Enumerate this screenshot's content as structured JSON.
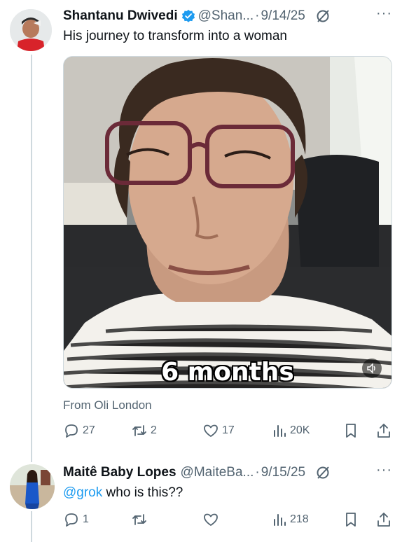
{
  "colors": {
    "link": "#1d9bf0",
    "muted": "#536471",
    "text": "#0f1419",
    "verified": "#1d9bf0"
  },
  "tweet1": {
    "name": "Shantanu Dwivedi",
    "handle": "@Shan...",
    "date": "9/14/25",
    "text": "His journey to transform into a woman",
    "media_caption": "6 months",
    "source": "From Oli London",
    "stats": {
      "replies": "27",
      "reposts": "2",
      "likes": "17",
      "views": "20K"
    }
  },
  "tweet2": {
    "name": "Maitê Baby Lopes",
    "handle": "@MaiteBa...",
    "date": "9/15/25",
    "mention": "@grok",
    "text": " who is this??",
    "stats": {
      "replies": "1",
      "reposts": "",
      "likes": "",
      "views": "218"
    }
  },
  "icons": [
    "verified-badge-icon",
    "grok-icon",
    "more-icon",
    "reply-icon",
    "repost-icon",
    "like-icon",
    "views-icon",
    "bookmark-icon",
    "share-icon",
    "sound-icon"
  ]
}
